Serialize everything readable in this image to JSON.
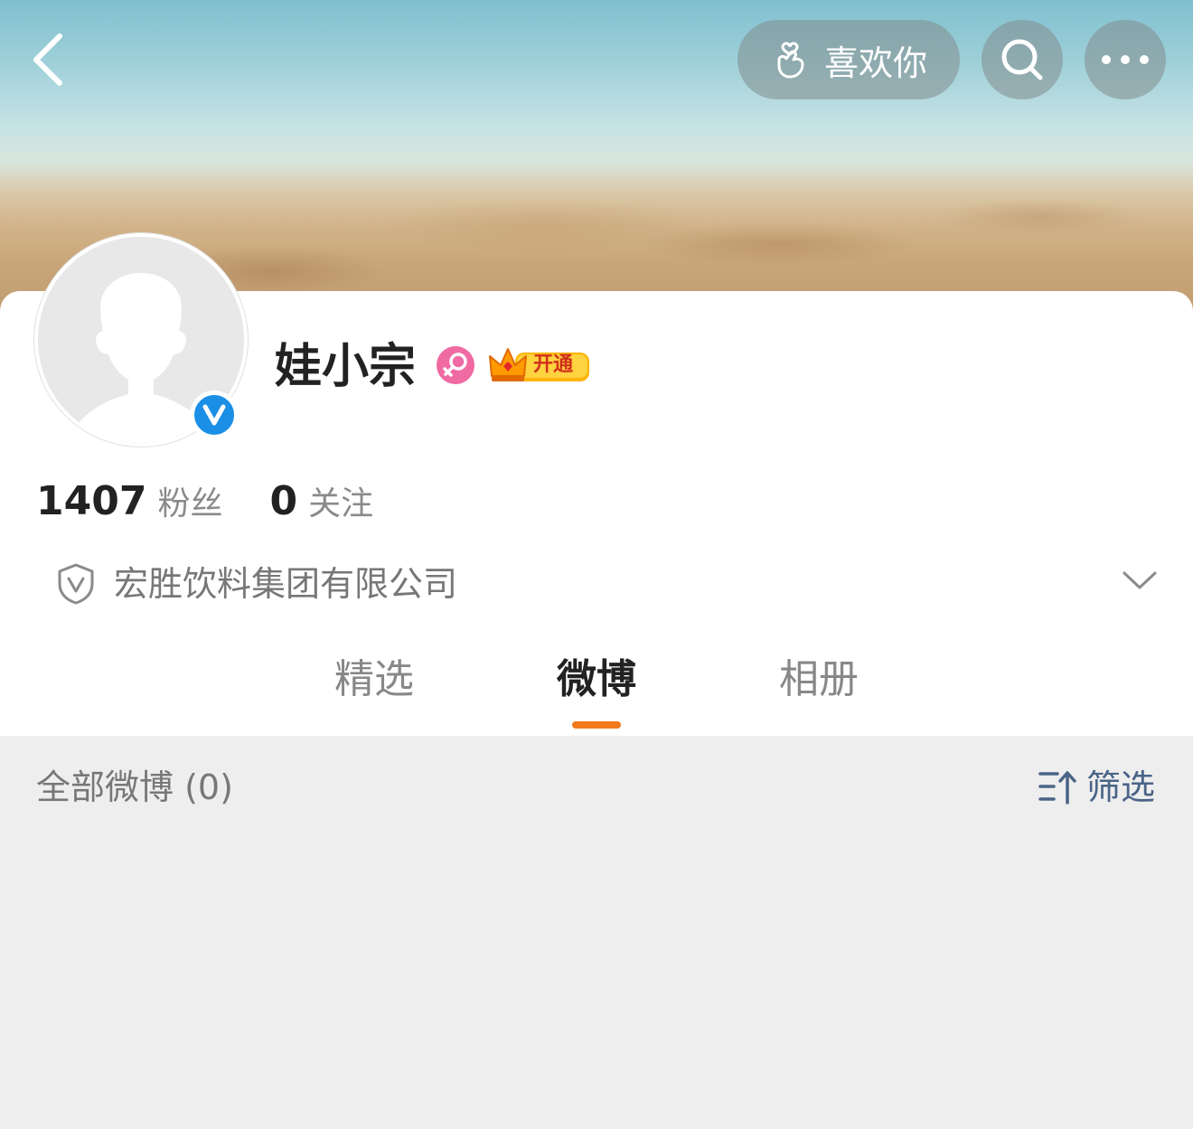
{
  "header": {
    "like_label": "喜欢你"
  },
  "profile": {
    "name": "娃小宗",
    "vip_label": "开通",
    "followers_count": "1407",
    "followers_label": "粉丝",
    "following_count": "0",
    "following_label": "关注",
    "company": "宏胜饮料集团有限公司"
  },
  "tabs": [
    {
      "label": "精选",
      "active": false
    },
    {
      "label": "微博",
      "active": true
    },
    {
      "label": "相册",
      "active": false
    }
  ],
  "feed": {
    "title": "全部微博 (0)",
    "filter_label": "筛选"
  },
  "colors": {
    "accent": "#f27a1a",
    "verify_blue": "#1b8fe6",
    "gender_pink": "#f06aa3",
    "filter_blue": "#4a6486"
  },
  "icons": [
    "back-arrow-icon",
    "hand-heart-icon",
    "search-icon",
    "more-icon",
    "verified-icon",
    "female-icon",
    "crown-icon",
    "shield-icon",
    "chevron-down-icon",
    "sort-filter-icon"
  ]
}
